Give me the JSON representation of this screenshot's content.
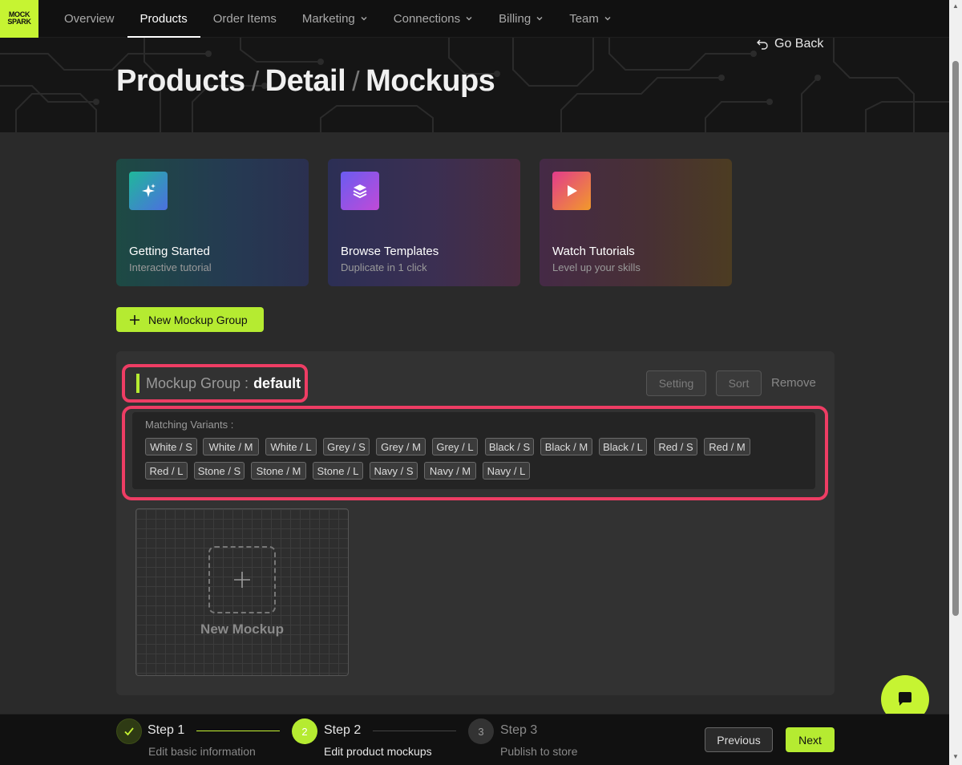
{
  "brand": {
    "logo_line1": "MOCK",
    "logo_line2": "SPARK",
    "accent": "#c6f432",
    "highlight": "#ee3d64"
  },
  "nav": {
    "items": [
      {
        "label": "Overview"
      },
      {
        "label": "Products"
      },
      {
        "label": "Order Items"
      },
      {
        "label": "Marketing"
      },
      {
        "label": "Connections"
      },
      {
        "label": "Billing"
      },
      {
        "label": "Team"
      }
    ],
    "active": "Products"
  },
  "header": {
    "crumb1": "Products",
    "crumb2": "Detail",
    "crumb3": "Mockups",
    "separator": "/",
    "go_back": "Go Back"
  },
  "cards": [
    {
      "title": "Getting Started",
      "subtitle": "Interactive tutorial",
      "icon": "sparkles-icon"
    },
    {
      "title": "Browse Templates",
      "subtitle": "Duplicate in 1 click",
      "icon": "layers-icon"
    },
    {
      "title": "Watch Tutorials",
      "subtitle": "Level up your skills",
      "icon": "play-icon"
    }
  ],
  "new_group_button": "New Mockup Group",
  "group": {
    "label": "Mockup Group :",
    "name": "default",
    "setting": "Setting",
    "sort": "Sort",
    "remove": "Remove",
    "matching_label": "Matching Variants :",
    "variants": [
      "White / S",
      "White / M",
      "White / L",
      "Grey / S",
      "Grey / M",
      "Grey / L",
      "Black / S",
      "Black / M",
      "Black / L",
      "Red / S",
      "Red / M",
      "Red / L",
      "Stone / S",
      "Stone / M",
      "Stone / L",
      "Navy / S",
      "Navy / M",
      "Navy / L"
    ]
  },
  "new_mockup": "New Mockup",
  "steps": [
    {
      "number": "1",
      "name": "Step 1",
      "desc": "Edit basic information",
      "status": "done"
    },
    {
      "number": "2",
      "name": "Step 2",
      "desc": "Edit product mockups",
      "status": "current"
    },
    {
      "number": "3",
      "name": "Step 3",
      "desc": "Publish to store",
      "status": "pending"
    }
  ],
  "footer": {
    "previous": "Previous",
    "next": "Next"
  }
}
